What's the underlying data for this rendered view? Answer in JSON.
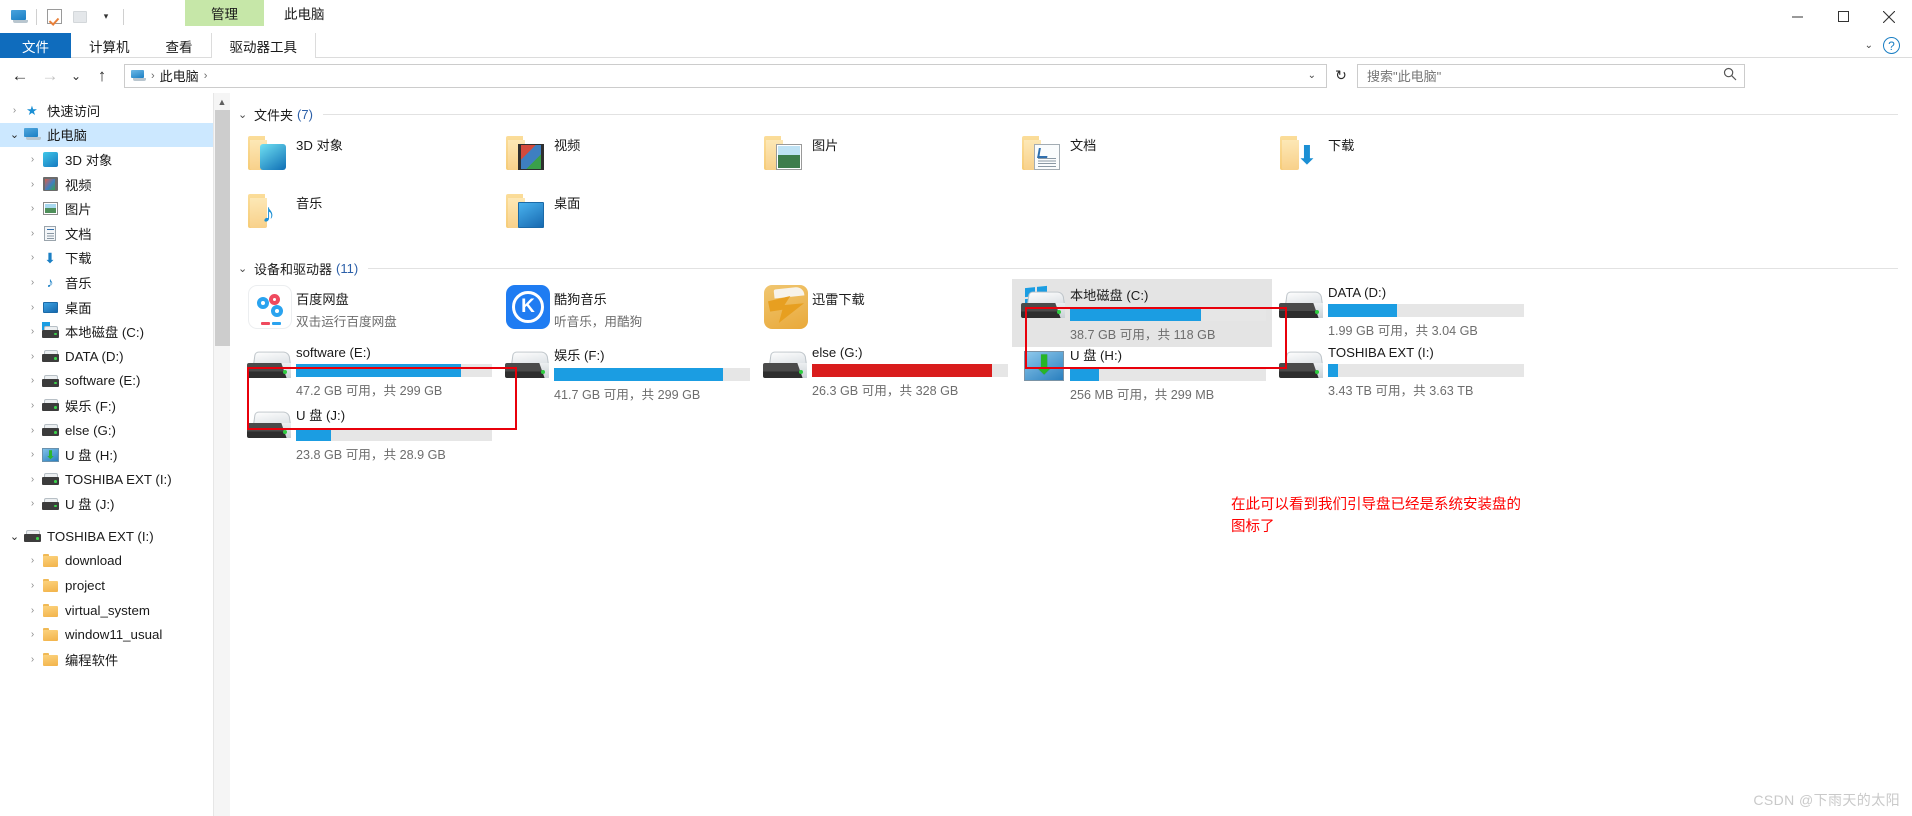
{
  "window": {
    "context_tab_label": "管理",
    "title": "此电脑",
    "minimize_label": "最小化",
    "maximize_label": "最大化",
    "close_label": "关闭"
  },
  "quick_access_toolbar": {
    "items": [
      {
        "name": "此电脑",
        "icon": "monitor-icon"
      },
      {
        "name": "属性",
        "icon": "checkbox-icon"
      },
      {
        "name": "新建文件夹",
        "icon": "folder-icon"
      },
      {
        "name": "自定义快速访问工具栏",
        "icon": "chevron-down-icon"
      }
    ]
  },
  "ribbon": {
    "tabs": [
      {
        "label": "文件",
        "active": true
      },
      {
        "label": "计算机",
        "active": false
      },
      {
        "label": "查看",
        "active": false
      },
      {
        "label": "驱动器工具",
        "active": false,
        "contextual": true
      }
    ],
    "collapse_icon": "chevron-down-icon",
    "help_icon": "question-mark-icon"
  },
  "navbar": {
    "back_icon": "arrow-left-icon",
    "forward_icon": "arrow-right-icon",
    "recent_icon": "chevron-down-icon",
    "up_icon": "arrow-up-icon",
    "address": {
      "computer_icon": "this-pc-icon",
      "crumbs": [
        "此电脑"
      ],
      "dropdown_icon": "chevron-down-icon"
    },
    "refresh_icon": "refresh-icon",
    "search": {
      "placeholder": "搜索\"此电脑\"",
      "value": "",
      "icon": "search-icon"
    }
  },
  "sidebar": {
    "items": [
      {
        "label": "快速访问",
        "icon": "star-icon",
        "indent": 0,
        "expander": "collapsed",
        "selected": false
      },
      {
        "label": "此电脑",
        "icon": "this-pc-icon",
        "indent": 0,
        "expander": "expanded",
        "selected": true
      },
      {
        "label": "3D 对象",
        "icon": "3d-objects-icon",
        "indent": 1,
        "expander": "collapsed",
        "selected": false
      },
      {
        "label": "视频",
        "icon": "videos-icon",
        "indent": 1,
        "expander": "collapsed",
        "selected": false
      },
      {
        "label": "图片",
        "icon": "pictures-icon",
        "indent": 1,
        "expander": "collapsed",
        "selected": false
      },
      {
        "label": "文档",
        "icon": "documents-icon",
        "indent": 1,
        "expander": "collapsed",
        "selected": false
      },
      {
        "label": "下载",
        "icon": "downloads-icon",
        "indent": 1,
        "expander": "collapsed",
        "selected": false
      },
      {
        "label": "音乐",
        "icon": "music-icon",
        "indent": 1,
        "expander": "collapsed",
        "selected": false
      },
      {
        "label": "桌面",
        "icon": "desktop-icon",
        "indent": 1,
        "expander": "collapsed",
        "selected": false
      },
      {
        "label": "本地磁盘 (C:)",
        "icon": "windows-drive-icon",
        "indent": 1,
        "expander": "collapsed",
        "selected": false
      },
      {
        "label": "DATA (D:)",
        "icon": "drive-icon",
        "indent": 1,
        "expander": "collapsed",
        "selected": false
      },
      {
        "label": "software (E:)",
        "icon": "drive-icon",
        "indent": 1,
        "expander": "collapsed",
        "selected": false
      },
      {
        "label": "娱乐 (F:)",
        "icon": "drive-icon",
        "indent": 1,
        "expander": "collapsed",
        "selected": false
      },
      {
        "label": "else (G:)",
        "icon": "drive-icon",
        "indent": 1,
        "expander": "collapsed",
        "selected": false
      },
      {
        "label": "U 盘 (H:)",
        "icon": "usb-installer-icon",
        "indent": 1,
        "expander": "collapsed",
        "selected": false
      },
      {
        "label": "TOSHIBA EXT (I:)",
        "icon": "drive-icon",
        "indent": 1,
        "expander": "collapsed",
        "selected": false
      },
      {
        "label": "U 盘 (J:)",
        "icon": "drive-icon",
        "indent": 1,
        "expander": "collapsed",
        "selected": false
      },
      {
        "label": "TOSHIBA EXT (I:)",
        "icon": "drive-icon",
        "indent": 0,
        "expander": "expanded",
        "selected": false,
        "spacer_above": true
      },
      {
        "label": "download",
        "icon": "folder-icon",
        "indent": 1,
        "expander": "collapsed",
        "selected": false
      },
      {
        "label": "project",
        "icon": "folder-icon",
        "indent": 1,
        "expander": "collapsed",
        "selected": false
      },
      {
        "label": "virtual_system",
        "icon": "folder-icon",
        "indent": 1,
        "expander": "collapsed",
        "selected": false
      },
      {
        "label": "window11_usual",
        "icon": "folder-icon",
        "indent": 1,
        "expander": "collapsed",
        "selected": false
      },
      {
        "label": "编程软件",
        "icon": "folder-icon",
        "indent": 1,
        "expander": "collapsed",
        "selected": false
      }
    ]
  },
  "content": {
    "groups": [
      {
        "name": "文件夹",
        "count": "(7)",
        "chevron": "chevron-down-icon"
      },
      {
        "name": "设备和驱动器",
        "count": "(11)",
        "chevron": "chevron-down-icon"
      }
    ],
    "folders": [
      {
        "label": "3D 对象",
        "icon": "folder-3d-objects-icon"
      },
      {
        "label": "视频",
        "icon": "folder-videos-icon"
      },
      {
        "label": "图片",
        "icon": "folder-pictures-icon"
      },
      {
        "label": "文档",
        "icon": "folder-documents-icon"
      },
      {
        "label": "下载",
        "icon": "folder-downloads-icon"
      },
      {
        "label": "音乐",
        "icon": "folder-music-icon"
      },
      {
        "label": "桌面",
        "icon": "folder-desktop-icon"
      }
    ],
    "apps": [
      {
        "label": "百度网盘",
        "sub": "双击运行百度网盘",
        "icon": "baidu-netdisk-icon"
      },
      {
        "label": "酷狗音乐",
        "sub": "听音乐，用酷狗",
        "icon": "kugou-music-icon"
      },
      {
        "label": "迅雷下载",
        "sub": "",
        "icon": "xunlei-icon"
      }
    ],
    "drives": [
      {
        "label": "本地磁盘 (C:)",
        "sub": "38.7 GB 可用，共 118 GB",
        "used_percent": 67,
        "bar_color": "#1b9de2",
        "icon": "windows-drive-icon",
        "selected": true,
        "highlighted": false
      },
      {
        "label": "DATA (D:)",
        "sub": "1.99 GB 可用，共 3.04 GB",
        "used_percent": 35,
        "bar_color": "#1b9de2",
        "icon": "drive-icon",
        "selected": false,
        "highlighted": false
      },
      {
        "label": "software (E:)",
        "sub": "47.2 GB 可用，共 299 GB",
        "used_percent": 84,
        "bar_color": "#1b9de2",
        "icon": "drive-icon",
        "selected": false,
        "highlighted": false
      },
      {
        "label": "娱乐 (F:)",
        "sub": "41.7 GB 可用，共 299 GB",
        "used_percent": 86,
        "bar_color": "#1b9de2",
        "icon": "drive-icon",
        "selected": false,
        "highlighted": false
      },
      {
        "label": "else (G:)",
        "sub": "26.3 GB 可用，共 328 GB",
        "used_percent": 92,
        "bar_color": "#d91c1c",
        "icon": "drive-icon",
        "selected": false,
        "highlighted": false
      },
      {
        "label": "U 盘 (H:)",
        "sub": "256 MB 可用，共 299 MB",
        "used_percent": 15,
        "bar_color": "#1b9de2",
        "icon": "usb-installer-icon",
        "selected": false,
        "highlighted": true
      },
      {
        "label": "TOSHIBA EXT (I:)",
        "sub": "3.43 TB 可用，共 3.63 TB",
        "used_percent": 5,
        "bar_color": "#1b9de2",
        "icon": "drive-icon",
        "selected": false,
        "highlighted": false
      },
      {
        "label": "U 盘 (J:)",
        "sub": "23.8 GB 可用，共 28.9 GB",
        "used_percent": 18,
        "bar_color": "#1b9de2",
        "icon": "drive-icon",
        "selected": false,
        "highlighted": true
      }
    ]
  },
  "annotation": {
    "text": "在此可以看到我们引导盘已经是系统安装盘的\n图标了",
    "color": "#ff0000"
  },
  "watermark": {
    "text": "CSDN @下雨天的太阳"
  }
}
